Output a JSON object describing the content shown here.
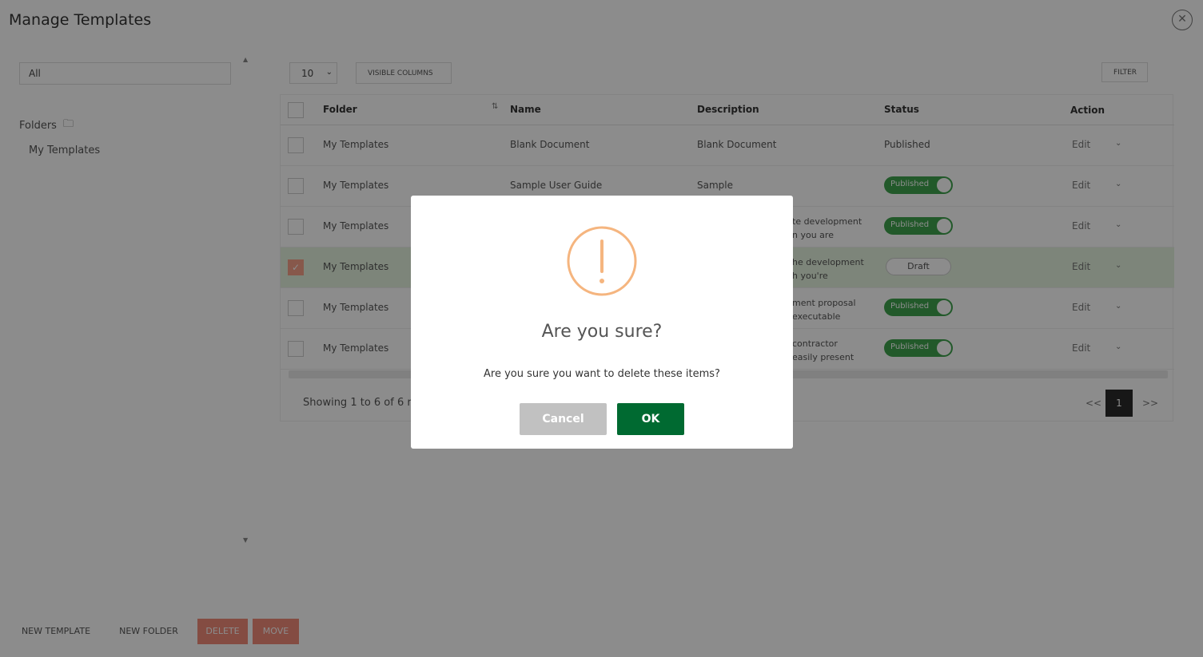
{
  "window": {
    "title": "Manage Templates",
    "close_icon": "close-icon"
  },
  "sidebar": {
    "search_value": "All",
    "folders_label": "Folders",
    "folders_icon": "folder-icon",
    "items": [
      {
        "label": "My Templates"
      }
    ]
  },
  "toolbar": {
    "page_size": "10",
    "visible_columns_label": "VISIBLE COLUMNS",
    "filter_label": "FILTER"
  },
  "table": {
    "columns": [
      "Folder",
      "Name",
      "Description",
      "Status",
      "Action"
    ],
    "rows": [
      {
        "folder": "My Templates",
        "name": "Blank Document",
        "description": "Blank Document",
        "status": "Published",
        "status_style": "text",
        "action": "Edit",
        "checked": false
      },
      {
        "folder": "My Templates",
        "name": "Sample User Guide",
        "description": "Sample",
        "status": "Published",
        "status_style": "toggle",
        "action": "Edit",
        "checked": false
      },
      {
        "folder": "My Templates",
        "name": "",
        "description_l1": "te development",
        "description_l2": "n you are",
        "status": "Published",
        "status_style": "toggle",
        "action": "Edit",
        "checked": false
      },
      {
        "folder": "My Templates",
        "name": "",
        "description_l1": "he development",
        "description_l2": "h you're",
        "status": "Draft",
        "status_style": "draft",
        "action": "Edit",
        "checked": true
      },
      {
        "folder": "My Templates",
        "name": "",
        "description_l1": "ment proposal",
        "description_l2": "executable",
        "status": "Published",
        "status_style": "toggle",
        "action": "Edit",
        "checked": false
      },
      {
        "folder": "My Templates",
        "name": "",
        "description_l1": "contractor",
        "description_l2": "easily present",
        "status": "Published",
        "status_style": "toggle",
        "action": "Edit",
        "checked": false
      }
    ],
    "footer_text": "Showing 1 to 6 of 6 r",
    "pagination": {
      "prev": "<<",
      "current": "1",
      "next": ">>"
    }
  },
  "bottom_bar": {
    "new_template": "NEW TEMPLATE",
    "new_folder": "NEW FOLDER",
    "delete": "DELETE",
    "move": "MOVE"
  },
  "dialog": {
    "icon": "warning-icon",
    "title": "Are you sure?",
    "message": "Are you sure you want to delete these items?",
    "cancel_label": "Cancel",
    "ok_label": "OK",
    "colors": {
      "ok": "#006a31",
      "cancel": "#c1c1c1",
      "icon": "#f5b57f"
    }
  }
}
